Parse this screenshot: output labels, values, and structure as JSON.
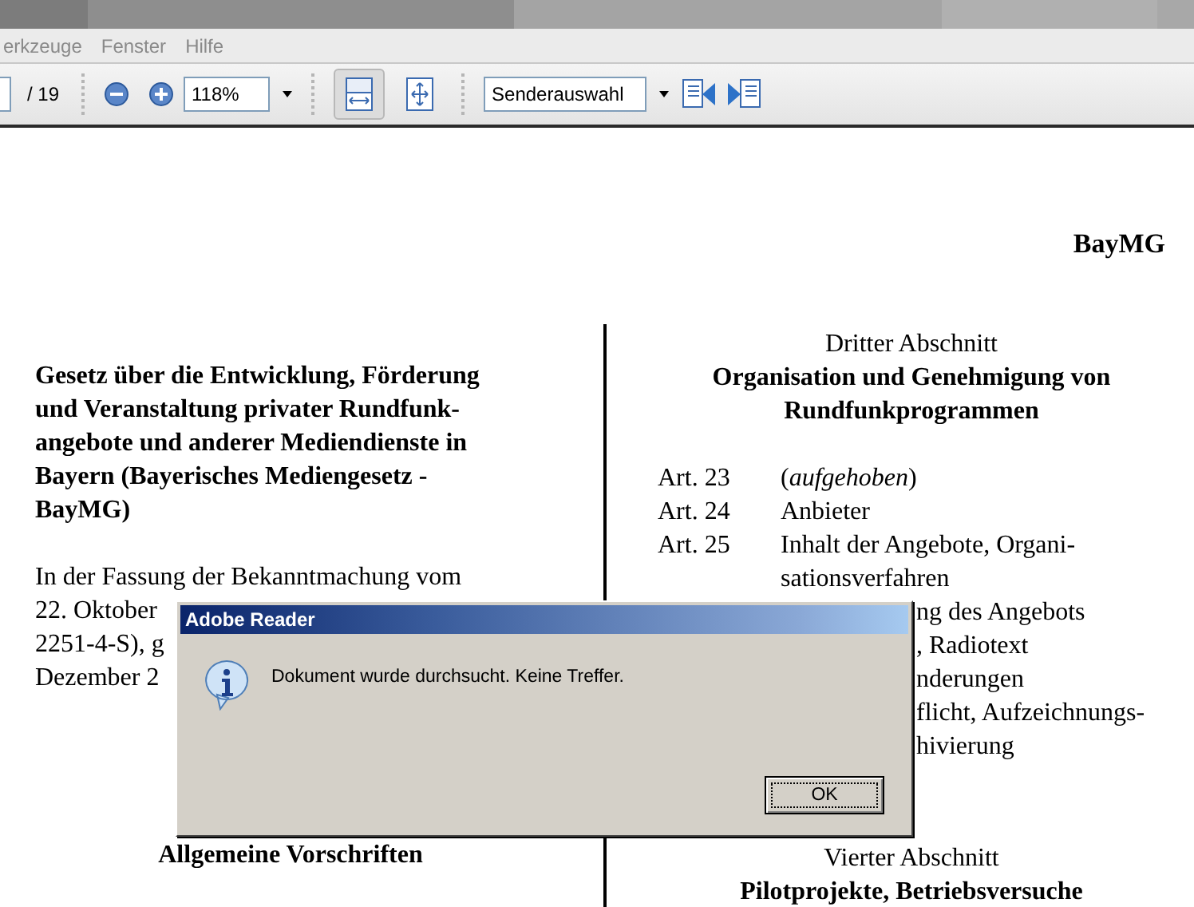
{
  "menu": [
    {
      "label": "erkzeuge"
    },
    {
      "label": "Fenster"
    },
    {
      "label": "Hilfe"
    }
  ],
  "toolbar": {
    "page_total": "/ 19",
    "zoom": "118%",
    "fit_width_pressed": true,
    "search_combo": "Senderauswahl"
  },
  "document": {
    "header": "BayMG",
    "left": {
      "title_lines": [
        "Gesetz über die Entwicklung, Förderung",
        "und Veranstaltung privater Rundfunk-",
        "angebote und anderer Mediendienste in",
        "Bayern (Bayerisches Mediengesetz -",
        "BayMG)"
      ],
      "paragraph_lines": [
        "In der Fassung der Bekanntmachung vom",
        "22. Oktober",
        "2251-4-S), g",
        "Dezember 2"
      ],
      "section_title": "Allgemeine Vorschriften"
    },
    "right": {
      "section_label": "Dritter Abschnitt",
      "section_title_lines": [
        "Organisation und Genehmigung von",
        "Rundfunkprogrammen"
      ],
      "entries": [
        {
          "kind": "article",
          "number": "Art. 23",
          "lines": [
            "(*aufgehoben*)"
          ]
        },
        {
          "kind": "article",
          "number": "Art. 24",
          "lines": [
            "Anbieter"
          ]
        },
        {
          "kind": "article",
          "number": "Art. 25",
          "lines": [
            "Inhalt der Angebote, Organi-",
            "sationsverfahren"
          ]
        },
        {
          "kind": "fragment",
          "text": "ng des Angebots"
        },
        {
          "kind": "fragment",
          "text": ", Radiotext"
        },
        {
          "kind": "fragment",
          "text": "nderungen"
        },
        {
          "kind": "fragment",
          "text": "flicht, Aufzeichnungs-"
        },
        {
          "kind": "fragment",
          "text": "hivierung"
        }
      ],
      "next_label": "Vierter Abschnitt",
      "next_title": "Pilotprojekte, Betriebsversuche"
    }
  },
  "dialog": {
    "title": "Adobe Reader",
    "message": "Dokument wurde durchsucht. Keine Treffer.",
    "button": "OK"
  }
}
